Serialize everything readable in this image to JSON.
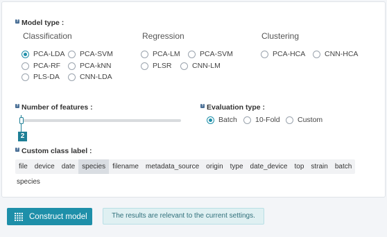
{
  "model_type": {
    "label": "Model type :",
    "groups": [
      {
        "header": "Classification",
        "options": [
          "PCA-LDA",
          "PCA-SVM",
          "PCA-RF",
          "PCA-kNN",
          "PLS-DA",
          "CNN-LDA"
        ]
      },
      {
        "header": "Regression",
        "options": [
          "PCA-LM",
          "PCA-SVM",
          "PLSR",
          "CNN-LM"
        ]
      },
      {
        "header": "Clustering",
        "options": [
          "PCA-HCA",
          "CNN-HCA"
        ]
      }
    ],
    "selected": "PCA-LDA"
  },
  "num_features": {
    "label": "Number of features :",
    "value": "2"
  },
  "evaluation_type": {
    "label": "Evaluation type :",
    "options": [
      "Batch",
      "10-Fold",
      "Custom"
    ],
    "selected": "Batch"
  },
  "custom_class_label": {
    "label": "Custom class label :",
    "chips": [
      "file",
      "device",
      "date",
      "species",
      "filename",
      "metadata_source",
      "origin",
      "type",
      "date_device",
      "top",
      "strain",
      "batch"
    ],
    "selected_chip": "species",
    "selected_value": "species"
  },
  "actions": {
    "construct_label": "Construct model",
    "status": "The results are relevant to the current settings."
  },
  "help_icon_text": "?",
  "colors": {
    "accent": "#1e8fa9",
    "status_bg": "#dff0f2"
  },
  "icons": {
    "help": "help-icon",
    "construct": "grid-icon"
  }
}
